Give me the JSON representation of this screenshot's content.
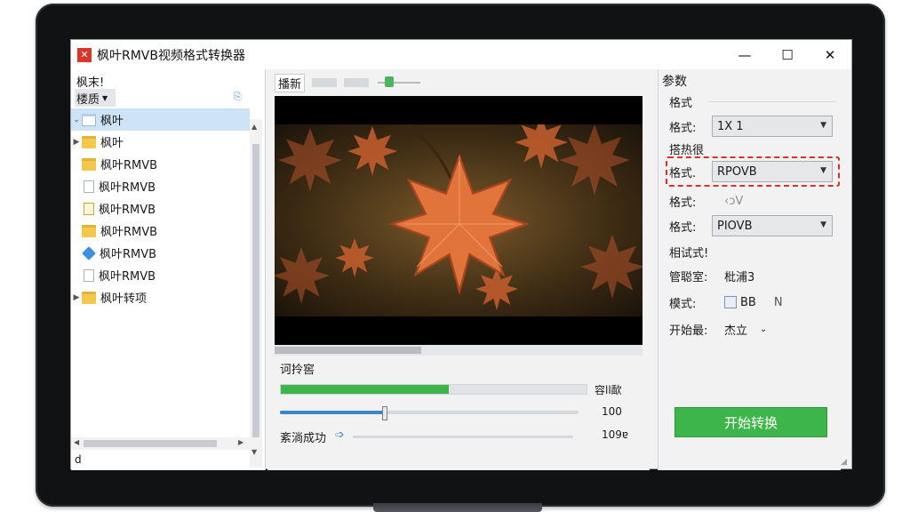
{
  "window": {
    "title": "枫叶RMVB视频格式转换器",
    "minimize": "—",
    "maximize": "☐",
    "close": "✕"
  },
  "left_panel": {
    "header": "枫末!",
    "sort_label": "楼质",
    "footer": "d",
    "tree": [
      {
        "label": "枫叶",
        "icon": "folder-open-icon",
        "expanded": true,
        "selected": true
      },
      {
        "label": "枫叶",
        "icon": "folder-icon",
        "expanded": false
      },
      {
        "label": "枫叶RMVB",
        "icon": "folder-icon"
      },
      {
        "label": "枫叶RMVB",
        "icon": "document-icon"
      },
      {
        "label": "枫叶RMVB",
        "icon": "document-gold-icon"
      },
      {
        "label": "枫叶RMVB",
        "icon": "folder-icon"
      },
      {
        "label": "枫叶RMVB",
        "icon": "diamond-icon"
      },
      {
        "label": "枫叶RMVB",
        "icon": "document-icon"
      },
      {
        "label": "枫叶转项",
        "icon": "folder-icon",
        "expanded": false
      }
    ]
  },
  "preview": {
    "tab_label": "播新",
    "progress_title": "诃拎窖",
    "progress_bar_label": "容ll歃",
    "progress_value": 0.55,
    "slider_value_label": "100",
    "slider_value": 0.35,
    "status_label": "紊淌成功",
    "status_value_label": "109ɐ"
  },
  "params": {
    "title": "参数",
    "section_format": "格式",
    "row1_label": "格式:",
    "row1_value": "1X 1",
    "section_capture": "搭热很",
    "row2_label": "格式.",
    "row2_value": "RPOVB",
    "row3_label": "格式:",
    "row3_value": "‹ↄV",
    "row4_label": "格式:",
    "row4_value": "PIOVB",
    "section_test": "相试式!",
    "row5_label": "管聪室:",
    "row5_value": "枇浦3",
    "row6_label": "模式:",
    "row6_value": "BB",
    "row6_suffix": "N",
    "row7_label": "开始最:",
    "row7_value": "杰立",
    "convert_button": "开始转换"
  },
  "colors": {
    "accent_green": "#3db54a",
    "selection_blue": "#cfe3f7",
    "highlight_red": "#d9302a",
    "slider_blue": "#3b87c9"
  }
}
